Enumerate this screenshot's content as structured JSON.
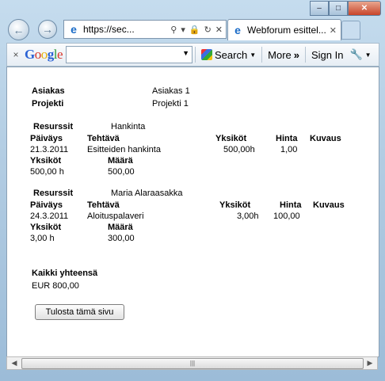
{
  "browser": {
    "address": {
      "url": "https://sec..."
    },
    "tab": {
      "title": "Webforum esittel..."
    },
    "toolbar": {
      "close_glyph": "×",
      "logo": "Google",
      "search_label": "Search",
      "more_label": "More",
      "signin_label": "Sign In"
    }
  },
  "page": {
    "customer_label": "Asiakas",
    "customer_value": "Asiakas 1",
    "project_label": "Projekti",
    "project_value": "Projekti 1",
    "headers": {
      "resources": "Resurssit",
      "date": "Päiväys",
      "task": "Tehtävä",
      "units": "Yksiköt",
      "price": "Hinta",
      "description": "Kuvaus",
      "amount": "Määrä"
    },
    "entries": [
      {
        "resource": "Hankinta",
        "date": "21.3.2011",
        "task": "Esitteiden hankinta",
        "units": "500,00h",
        "price": "1,00",
        "description": "",
        "units_total": "500,00 h",
        "amount": "500,00"
      },
      {
        "resource": "Maria Alaraasakka",
        "date": "24.3.2011",
        "task": "Aloituspalaveri",
        "units": "3,00h",
        "price": "100,00",
        "description": "",
        "units_total": "3,00 h",
        "amount": "300,00"
      }
    ],
    "total_label": "Kaikki yhteensä",
    "total_value": "EUR 800,00",
    "print_button": "Tulosta tämä sivu"
  }
}
